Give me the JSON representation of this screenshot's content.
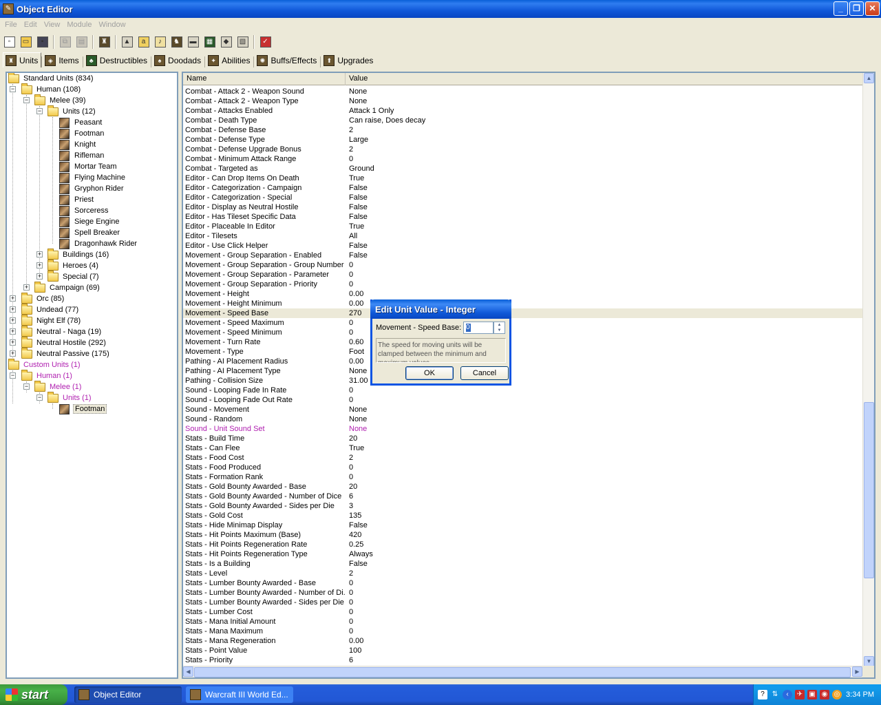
{
  "window": {
    "title": "Object Editor"
  },
  "menu": [
    "File",
    "Edit",
    "View",
    "Module",
    "Window"
  ],
  "toolbar_icons": [
    "new-icon",
    "open-icon",
    "save-icon",
    "copy-icon",
    "paste-icon",
    "unit-icon",
    "terrain-icon",
    "gold-icon",
    "sound-icon",
    "object-icon",
    "camera-icon",
    "region-icon",
    "import-icon",
    "export-icon",
    "test-map-icon"
  ],
  "tabs": [
    {
      "label": "Units",
      "active": true
    },
    {
      "label": "Items"
    },
    {
      "label": "Destructibles"
    },
    {
      "label": "Doodads"
    },
    {
      "label": "Abilities"
    },
    {
      "label": "Buffs/Effects"
    },
    {
      "label": "Upgrades"
    }
  ],
  "tree": {
    "standard_root": "Standard Units (834)",
    "human": "Human (108)",
    "melee": "Melee (39)",
    "units": "Units (12)",
    "unit_list": [
      "Peasant",
      "Footman",
      "Knight",
      "Rifleman",
      "Mortar Team",
      "Flying Machine",
      "Gryphon Rider",
      "Priest",
      "Sorceress",
      "Siege Engine",
      "Spell Breaker",
      "Dragonhawk Rider"
    ],
    "buildings": "Buildings (16)",
    "heroes": "Heroes (4)",
    "special": "Special (7)",
    "campaign": "Campaign (69)",
    "races": [
      "Orc (85)",
      "Undead (77)",
      "Night Elf (78)",
      "Neutral - Naga (19)",
      "Neutral Hostile (292)",
      "Neutral Passive (175)"
    ],
    "custom_root": "Custom Units (1)",
    "custom_human": "Human (1)",
    "custom_melee": "Melee (1)",
    "custom_units": "Units (1)",
    "custom_unit": "Footman"
  },
  "grid": {
    "col_name": "Name",
    "col_value": "Value",
    "rows": [
      [
        "Combat - Attack 2 - Weapon Sound",
        "None"
      ],
      [
        "Combat - Attack 2 - Weapon Type",
        "None"
      ],
      [
        "Combat - Attacks Enabled",
        "Attack 1 Only"
      ],
      [
        "Combat - Death Type",
        "Can raise, Does decay"
      ],
      [
        "Combat - Defense Base",
        "2"
      ],
      [
        "Combat - Defense Type",
        "Large"
      ],
      [
        "Combat - Defense Upgrade Bonus",
        "2"
      ],
      [
        "Combat - Minimum Attack Range",
        "0"
      ],
      [
        "Combat - Targeted as",
        "Ground"
      ],
      [
        "Editor - Can Drop Items On Death",
        "True"
      ],
      [
        "Editor - Categorization - Campaign",
        "False"
      ],
      [
        "Editor - Categorization - Special",
        "False"
      ],
      [
        "Editor - Display as Neutral Hostile",
        "False"
      ],
      [
        "Editor - Has Tileset Specific Data",
        "False"
      ],
      [
        "Editor - Placeable In Editor",
        "True"
      ],
      [
        "Editor - Tilesets",
        "All"
      ],
      [
        "Editor - Use Click Helper",
        "False"
      ],
      [
        "Movement - Group Separation - Enabled",
        "False"
      ],
      [
        "Movement - Group Separation - Group Number",
        "0"
      ],
      [
        "Movement - Group Separation - Parameter",
        "0"
      ],
      [
        "Movement - Group Separation - Priority",
        "0"
      ],
      [
        "Movement - Height",
        "0.00"
      ],
      [
        "Movement - Height Minimum",
        "0.00"
      ],
      [
        "Movement - Speed Base",
        "270"
      ],
      [
        "Movement - Speed Maximum",
        "0"
      ],
      [
        "Movement - Speed Minimum",
        "0"
      ],
      [
        "Movement - Turn Rate",
        "0.60"
      ],
      [
        "Movement - Type",
        "Foot"
      ],
      [
        "Pathing - AI Placement Radius",
        "0.00"
      ],
      [
        "Pathing - AI Placement Type",
        "None"
      ],
      [
        "Pathing - Collision Size",
        "31.00"
      ],
      [
        "Sound - Looping Fade In Rate",
        "0"
      ],
      [
        "Sound - Looping Fade Out Rate",
        "0"
      ],
      [
        "Sound - Movement",
        "None"
      ],
      [
        "Sound - Random",
        "None"
      ],
      [
        "Sound - Unit Sound Set",
        "None"
      ],
      [
        "Stats - Build Time",
        "20"
      ],
      [
        "Stats - Can Flee",
        "True"
      ],
      [
        "Stats - Food Cost",
        "2"
      ],
      [
        "Stats - Food Produced",
        "0"
      ],
      [
        "Stats - Formation Rank",
        "0"
      ],
      [
        "Stats - Gold Bounty Awarded - Base",
        "20"
      ],
      [
        "Stats - Gold Bounty Awarded - Number of Dice",
        "6"
      ],
      [
        "Stats - Gold Bounty Awarded - Sides per Die",
        "3"
      ],
      [
        "Stats - Gold Cost",
        "135"
      ],
      [
        "Stats - Hide Minimap Display",
        "False"
      ],
      [
        "Stats - Hit Points Maximum (Base)",
        "420"
      ],
      [
        "Stats - Hit Points Regeneration Rate",
        "0.25"
      ],
      [
        "Stats - Hit Points Regeneration Type",
        "Always"
      ],
      [
        "Stats - Is a Building",
        "False"
      ],
      [
        "Stats - Level",
        "2"
      ],
      [
        "Stats - Lumber Bounty Awarded - Base",
        "0"
      ],
      [
        "Stats - Lumber Bounty Awarded - Number of Di...",
        "0"
      ],
      [
        "Stats - Lumber Bounty Awarded - Sides per Die",
        "0"
      ],
      [
        "Stats - Lumber Cost",
        "0"
      ],
      [
        "Stats - Mana Initial Amount",
        "0"
      ],
      [
        "Stats - Mana Maximum",
        "0"
      ],
      [
        "Stats - Mana Regeneration",
        "0.00"
      ],
      [
        "Stats - Point Value",
        "100"
      ],
      [
        "Stats - Priority",
        "6"
      ]
    ],
    "selected_row": 23,
    "modified_row": 35
  },
  "dialog": {
    "title": "Edit Unit Value - Integer",
    "label": "Movement - Speed Base:",
    "value": "0",
    "help": "The speed for moving units will be clamped between the minimum and maximum values.",
    "ok": "OK",
    "cancel": "Cancel"
  },
  "taskbar": {
    "start": "start",
    "tasks": [
      "Object Editor",
      "Warcraft III World Ed..."
    ],
    "clock": "3:34 PM"
  },
  "colors": {
    "modified": "#b020b0",
    "selection": "#316ac5"
  }
}
